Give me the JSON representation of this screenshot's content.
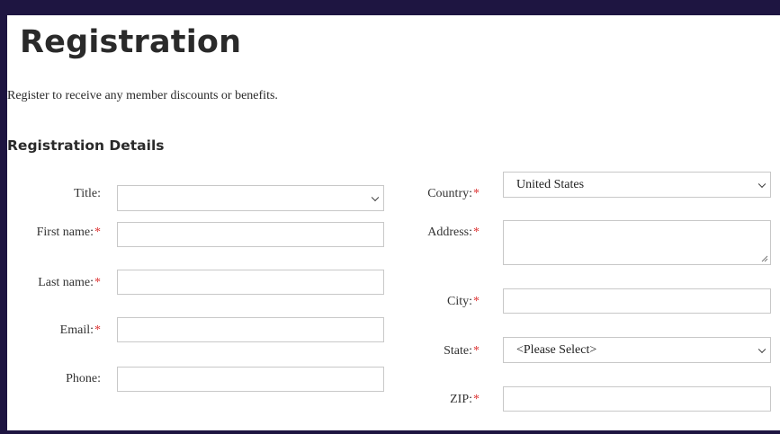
{
  "page": {
    "title": "Registration",
    "intro": "Register to receive any member discounts or benefits.",
    "section_title": "Registration Details"
  },
  "form": {
    "left": {
      "title_label": "Title:",
      "title_value": "",
      "first_name_label": "First name:",
      "first_name_value": "",
      "last_name_label": "Last name:",
      "last_name_value": "",
      "email_label": "Email:",
      "email_value": "",
      "phone_label": "Phone:",
      "phone_value": ""
    },
    "right": {
      "country_label": "Country:",
      "country_value": "United States",
      "address_label": "Address:",
      "address_value": "",
      "city_label": "City:",
      "city_value": "",
      "state_label": "State:",
      "state_value": "<Please Select>",
      "zip_label": "ZIP:",
      "zip_value": ""
    },
    "required_mark": "*"
  },
  "icons": {
    "dropdown": "chevron-down-icon",
    "resize": "resize-grip-icon"
  },
  "colors": {
    "frame": "#1e1541",
    "required": "#dd3333",
    "field_border": "#c8c8c8"
  }
}
